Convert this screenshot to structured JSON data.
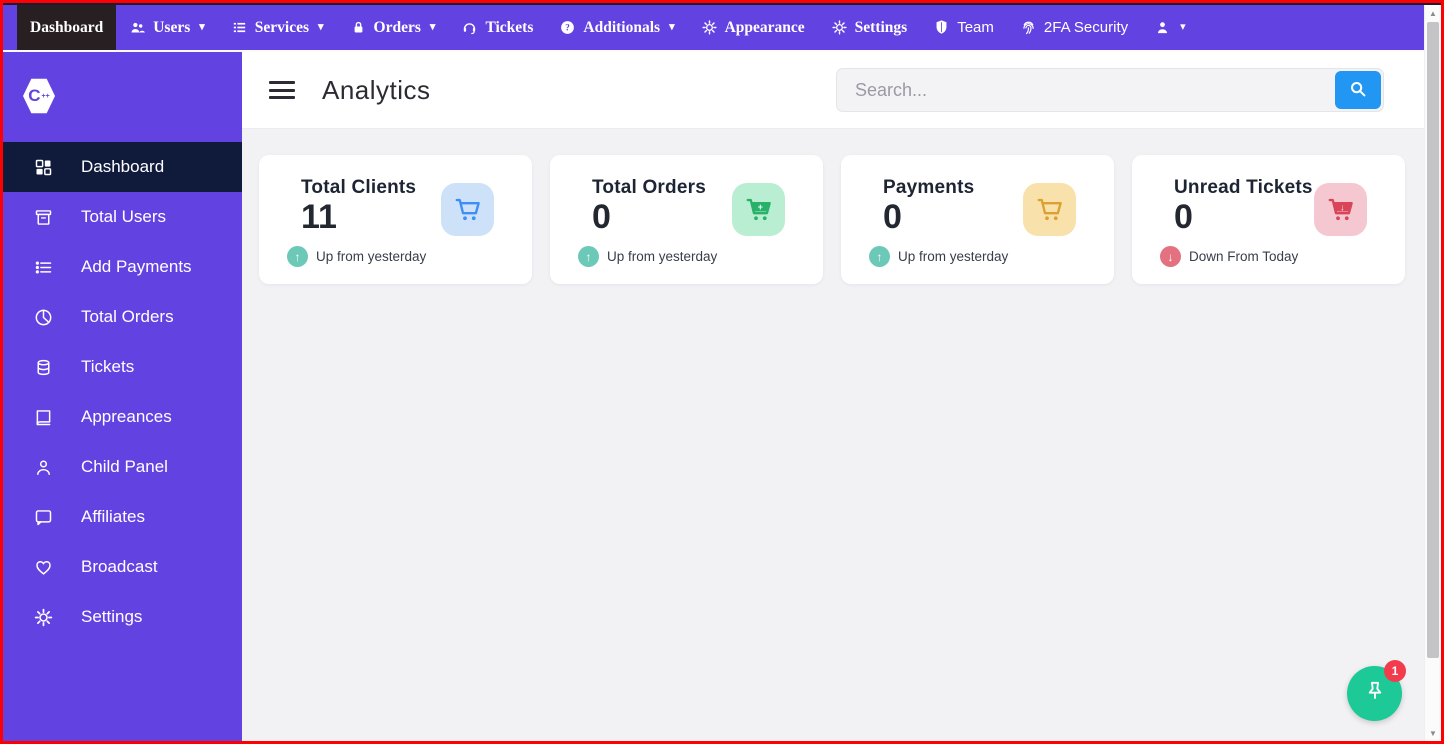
{
  "navbar": {
    "items": [
      {
        "label": "Dashboard",
        "icon": null,
        "caret": false,
        "active": true,
        "serif": true
      },
      {
        "label": "Users",
        "icon": "users-icon",
        "caret": true,
        "active": false,
        "serif": true
      },
      {
        "label": "Services",
        "icon": "services-icon",
        "caret": true,
        "active": false,
        "serif": true
      },
      {
        "label": "Orders",
        "icon": "lock-icon",
        "caret": true,
        "active": false,
        "serif": true
      },
      {
        "label": "Tickets",
        "icon": "headset-icon",
        "caret": false,
        "active": false,
        "serif": true
      },
      {
        "label": "Additionals",
        "icon": "question-icon",
        "caret": true,
        "active": false,
        "serif": true
      },
      {
        "label": "Appearance",
        "icon": "gear-flower-icon",
        "caret": false,
        "active": false,
        "serif": true
      },
      {
        "label": "Settings",
        "icon": "gear-icon",
        "caret": false,
        "active": false,
        "serif": true
      },
      {
        "label": "Team",
        "icon": "shield-icon",
        "caret": false,
        "active": false,
        "serif": false
      },
      {
        "label": "2FA Security",
        "icon": "fingerprint-icon",
        "caret": false,
        "active": false,
        "serif": false
      },
      {
        "label": "",
        "icon": "user-icon",
        "caret": true,
        "active": false,
        "serif": false
      }
    ]
  },
  "sidebar": {
    "logo_letter": "C",
    "logo_suffix": "++",
    "items": [
      {
        "label": "Dashboard",
        "icon": "grid-icon",
        "active": true
      },
      {
        "label": "Total Users",
        "icon": "archive-icon",
        "active": false
      },
      {
        "label": "Add Payments",
        "icon": "list-icon",
        "active": false
      },
      {
        "label": "Total Orders",
        "icon": "pie-chart-icon",
        "active": false
      },
      {
        "label": "Tickets",
        "icon": "database-icon",
        "active": false
      },
      {
        "label": "Appreances",
        "icon": "book-icon",
        "active": false
      },
      {
        "label": "Child Panel",
        "icon": "person-icon",
        "active": false
      },
      {
        "label": "Affiliates",
        "icon": "chat-icon",
        "active": false
      },
      {
        "label": "Broadcast",
        "icon": "heart-icon",
        "active": false
      },
      {
        "label": "Settings",
        "icon": "gear-icon",
        "active": false
      }
    ]
  },
  "header": {
    "title": "Analytics",
    "search_placeholder": "Search..."
  },
  "cards": [
    {
      "title": "Total Clients",
      "value": "11",
      "trend": "Up from yesterday",
      "direction": "up",
      "icon": "cart-icon",
      "cart_variant": "outline",
      "icon_bg": "#cde1f8",
      "icon_color": "#3e8ef7"
    },
    {
      "title": "Total Orders",
      "value": "0",
      "trend": "Up from yesterday",
      "direction": "up",
      "icon": "cart-icon",
      "cart_variant": "solid-plus",
      "icon_bg": "#b9eed3",
      "icon_color": "#27b169"
    },
    {
      "title": "Payments",
      "value": "0",
      "trend": "Up from yesterday",
      "direction": "up",
      "icon": "cart-icon",
      "cart_variant": "outline",
      "icon_bg": "#f8e1ab",
      "icon_color": "#dda12f"
    },
    {
      "title": "Unread Tickets",
      "value": "0",
      "trend": "Down From Today",
      "direction": "down",
      "icon": "cart-icon",
      "cart_variant": "solid-down",
      "icon_bg": "#f5c8d1",
      "icon_color": "#d94458"
    }
  ],
  "fab": {
    "badge": "1",
    "icon": "pushpin-icon"
  },
  "colors": {
    "accent_purple": "#6342e2",
    "active_nav_dark": "#271f21",
    "active_side_navy": "#101b3c",
    "search_button_blue": "#2196f3",
    "fab_green": "#1ec998",
    "badge_red": "#f23c4d",
    "trend_up_teal": "#6cc9b7",
    "trend_down_pink": "#e4717f",
    "frame_border_red": "#fd0002"
  }
}
